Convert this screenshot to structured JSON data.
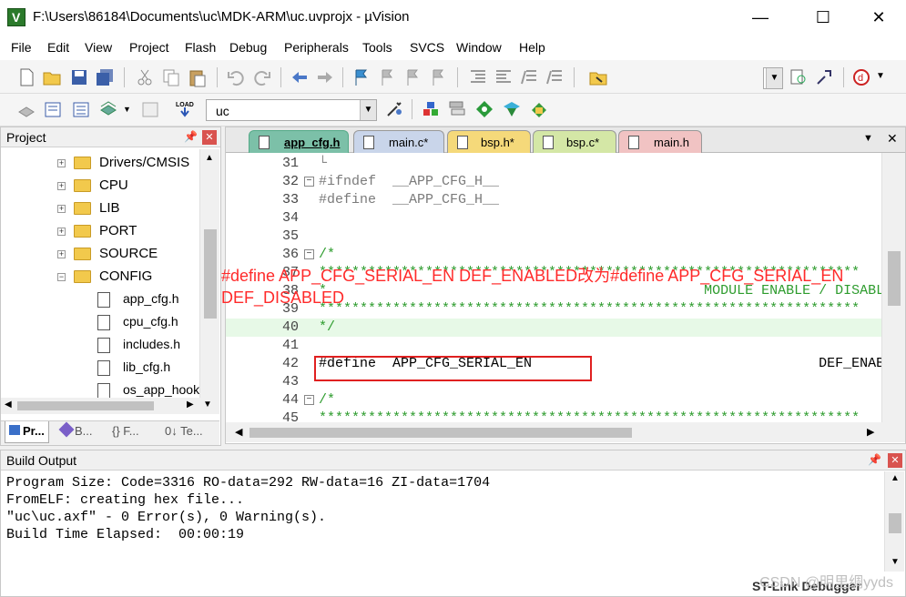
{
  "window": {
    "title": "F:\\Users\\86184\\Documents\\uc\\MDK-ARM\\uc.uvprojx - µVision",
    "minimize": "—",
    "maximize": "☐",
    "close": "✕"
  },
  "menu": [
    "File",
    "Edit",
    "View",
    "Project",
    "Flash",
    "Debug",
    "Peripherals",
    "Tools",
    "SVCS",
    "Window",
    "Help"
  ],
  "toolbar2": {
    "target_combo": "uc"
  },
  "project_panel": {
    "title": "Project",
    "tree": [
      {
        "label": "Drivers/CMSIS",
        "type": "folder",
        "expander": "+"
      },
      {
        "label": "CPU",
        "type": "folder",
        "expander": "+"
      },
      {
        "label": "LIB",
        "type": "folder",
        "expander": "+"
      },
      {
        "label": "PORT",
        "type": "folder",
        "expander": "+"
      },
      {
        "label": "SOURCE",
        "type": "folder",
        "expander": "+"
      },
      {
        "label": "CONFIG",
        "type": "folder",
        "expander": "−"
      },
      {
        "label": "app_cfg.h",
        "type": "file"
      },
      {
        "label": "cpu_cfg.h",
        "type": "file"
      },
      {
        "label": "includes.h",
        "type": "file"
      },
      {
        "label": "lib_cfg.h",
        "type": "file"
      },
      {
        "label": "os_app_hook",
        "type": "file"
      }
    ],
    "tabs": [
      "Pr...",
      "B...",
      "{} F...",
      "0↓ Te..."
    ]
  },
  "editor": {
    "tabs": [
      {
        "label": "app_cfg.h",
        "color": "#7cc0a8"
      },
      {
        "label": "main.c*",
        "color": "#c9d5ea"
      },
      {
        "label": "bsp.h*",
        "color": "#f5d97a"
      },
      {
        "label": "bsp.c*",
        "color": "#d4e7a6"
      },
      {
        "label": "main.h",
        "color": "#f1c3c3"
      }
    ],
    "lines": [
      {
        "num": "31",
        "fold": "",
        "text": "└",
        "cls": ""
      },
      {
        "num": "32",
        "fold": "−",
        "text": "#ifndef  __APP_CFG_H__",
        "cls": "pp"
      },
      {
        "num": "33",
        "fold": "",
        "text": "#define  __APP_CFG_H__",
        "cls": "pp"
      },
      {
        "num": "34",
        "fold": "",
        "text": "",
        "cls": ""
      },
      {
        "num": "35",
        "fold": "",
        "text": "",
        "cls": ""
      },
      {
        "num": "36",
        "fold": "−",
        "text": "/*",
        "cls": "cm"
      },
      {
        "num": "37",
        "fold": "",
        "text": "******************************************************************",
        "cls": "cm"
      },
      {
        "num": "38",
        "fold": "",
        "text": "*                                              MODULE ENABLE / DISABLE",
        "cls": "cm"
      },
      {
        "num": "39",
        "fold": "",
        "text": "******************************************************************",
        "cls": "cm"
      },
      {
        "num": "40",
        "fold": "",
        "text": "*/",
        "cls": "cm hl"
      },
      {
        "num": "41",
        "fold": "",
        "text": "",
        "cls": ""
      },
      {
        "num": "42",
        "fold": "",
        "text": "#define  APP_CFG_SERIAL_EN                                   DEF_ENABLED",
        "cls": "pp"
      },
      {
        "num": "43",
        "fold": "",
        "text": "",
        "cls": ""
      },
      {
        "num": "44",
        "fold": "−",
        "text": "/*",
        "cls": "cm"
      },
      {
        "num": "45",
        "fold": "",
        "text": "******************************************************************",
        "cls": "cm"
      }
    ]
  },
  "annotation": {
    "line1": "#define APP_CFG_SERIAL_EN DEF_ENABLED改为#define APP_CFG_SERIAL_EN",
    "line2": "DEF_DISABLED"
  },
  "build_output": {
    "title": "Build Output",
    "lines": [
      "Program Size: Code=3316 RO-data=292 RW-data=16 ZI-data=1704",
      "FromELF: creating hex file...",
      "\"uc\\uc.axf\" - 0 Error(s), 0 Warning(s).",
      "Build Time Elapsed:  00:00:19"
    ]
  },
  "status": {
    "debugger": "ST-Link Debugger"
  },
  "watermark": "CSDN @明里绸yyds"
}
